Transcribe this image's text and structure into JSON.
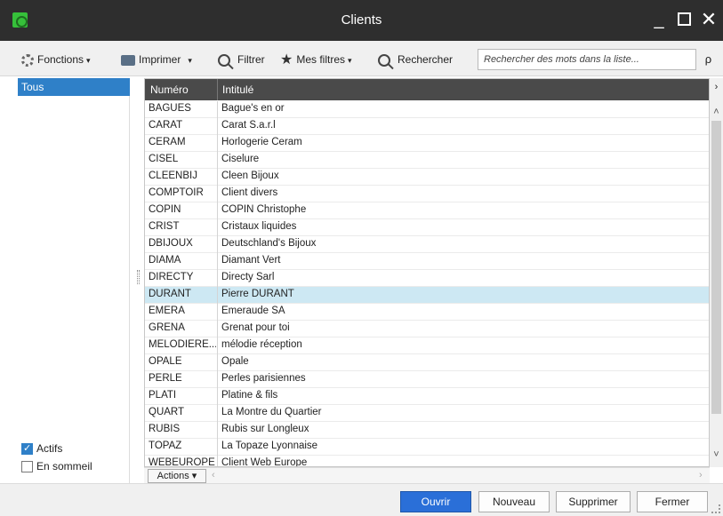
{
  "window": {
    "title": "Clients",
    "minimize_label": "_",
    "close_label": "✕"
  },
  "toolbar": {
    "fonctions_label": "Fonctions",
    "imprimer_label": "Imprimer",
    "filtrer_label": "Filtrer",
    "mes_filtres_label": "Mes filtres",
    "rechercher_label": "Rechercher",
    "search_placeholder": "Rechercher des mots dans la liste...",
    "search_button_label": "ρ",
    "caret": "▾",
    "star_glyph": "★"
  },
  "left_pane": {
    "selected_item": "Tous",
    "checkboxes": [
      {
        "label": "Actifs",
        "checked": true
      },
      {
        "label": "En sommeil",
        "checked": false
      }
    ]
  },
  "grid": {
    "columns": [
      "Numéro",
      "Intitulé"
    ],
    "rows": [
      {
        "numero": "BAGUES",
        "intitule": "Bague's en or"
      },
      {
        "numero": "CARAT",
        "intitule": "Carat S.a.r.l"
      },
      {
        "numero": "CERAM",
        "intitule": "Horlogerie Ceram"
      },
      {
        "numero": "CISEL",
        "intitule": "Ciselure"
      },
      {
        "numero": "CLEENBIJ",
        "intitule": "Cleen Bijoux"
      },
      {
        "numero": "COMPTOIR",
        "intitule": "Client divers"
      },
      {
        "numero": "COPIN",
        "intitule": "COPIN Christophe"
      },
      {
        "numero": "CRIST",
        "intitule": "Cristaux liquides"
      },
      {
        "numero": "DBIJOUX",
        "intitule": "Deutschland's Bijoux"
      },
      {
        "numero": "DIAMA",
        "intitule": "Diamant Vert"
      },
      {
        "numero": "DIRECTY",
        "intitule": "Directy Sarl"
      },
      {
        "numero": "DURANT",
        "intitule": "Pierre DURANT",
        "selected": true
      },
      {
        "numero": "EMERA",
        "intitule": "Emeraude SA"
      },
      {
        "numero": "GRENA",
        "intitule": "Grenat pour toi"
      },
      {
        "numero": "MELODIERE...",
        "intitule": "mélodie réception"
      },
      {
        "numero": "OPALE",
        "intitule": "Opale"
      },
      {
        "numero": "PERLE",
        "intitule": "Perles parisiennes"
      },
      {
        "numero": "PLATI",
        "intitule": "Platine & fils"
      },
      {
        "numero": "QUART",
        "intitule": "La Montre du Quartier"
      },
      {
        "numero": "RUBIS",
        "intitule": "Rubis sur Longleux"
      },
      {
        "numero": "TOPAZ",
        "intitule": "La Topaze Lyonnaise"
      },
      {
        "numero": "WEBEUROPE",
        "intitule": "Client Web Europe"
      }
    ],
    "actions_label": "Actions",
    "scroll_right": "›",
    "scroll_left": "‹",
    "scroll_up": "˄",
    "scroll_down": "˅"
  },
  "footer": {
    "ouvrir_label": "Ouvrir",
    "nouveau_label": "Nouveau",
    "supprimer_label": "Supprimer",
    "fermer_label": "Fermer"
  }
}
